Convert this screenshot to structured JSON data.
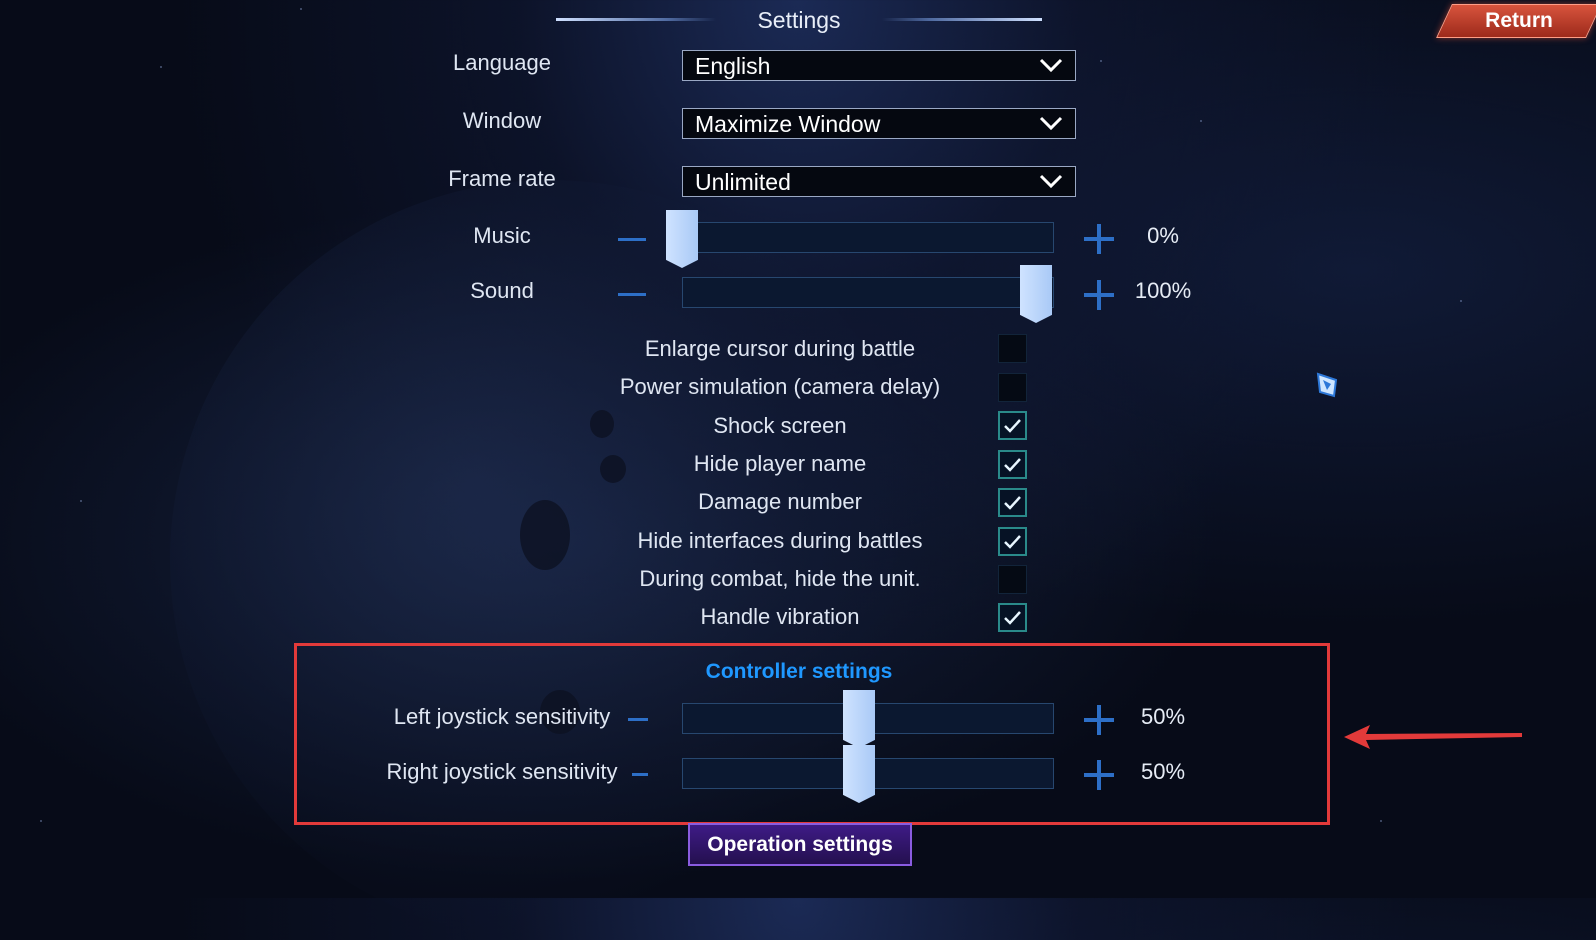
{
  "header": {
    "title": "Settings",
    "return_label": "Return"
  },
  "settings": {
    "language": {
      "label": "Language",
      "value": "English"
    },
    "window": {
      "label": "Window",
      "value": "Maximize Window"
    },
    "frame_rate": {
      "label": "Frame rate",
      "value": "Unlimited"
    },
    "music": {
      "label": "Music",
      "value": "0%",
      "level": 0
    },
    "sound": {
      "label": "Sound",
      "value": "100%",
      "level": 1
    }
  },
  "toggles": [
    {
      "label": "Enlarge cursor during battle",
      "checked": false
    },
    {
      "label": "Power simulation (camera delay)",
      "checked": false
    },
    {
      "label": "Shock screen",
      "checked": true
    },
    {
      "label": "Hide player name",
      "checked": true
    },
    {
      "label": "Damage number",
      "checked": true
    },
    {
      "label": "Hide interfaces during battles",
      "checked": true
    },
    {
      "label": "During combat, hide the unit.",
      "checked": false
    },
    {
      "label": "Handle vibration",
      "checked": true
    }
  ],
  "controller": {
    "title": "Controller settings",
    "left_joystick": {
      "label": "Left joystick sensitivity",
      "value": "50%",
      "level": 0.5
    },
    "right_joystick": {
      "label": "Right joystick sensitivity",
      "value": "50%",
      "level": 0.5
    }
  },
  "footer": {
    "operation_label": "Operation settings"
  },
  "colors": {
    "accent_blue": "#1f98ff",
    "highlight_red": "#e23a3a",
    "return_red": "#c4432f",
    "op_purple": "#3e1b86"
  },
  "icons": {
    "dropdown": "chevron-down-icon",
    "check": "check-icon",
    "increase": "plus-icon",
    "decrease": "minus-icon",
    "pointer": "cursor-icon",
    "annotation": "red-arrow-icon"
  }
}
